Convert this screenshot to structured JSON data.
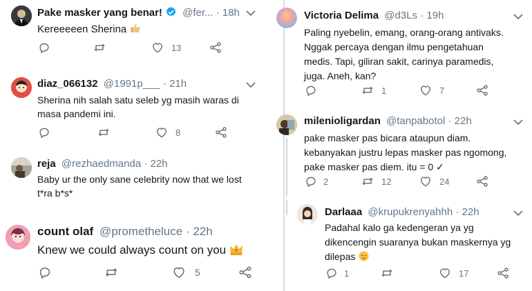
{
  "left_tweets": [
    {
      "name": "Pake masker yang benar!",
      "handle": "@fer...",
      "time": "18h",
      "text": "Kereeeeen Sherina",
      "reply": "",
      "retweet": "",
      "like": "13",
      "has_verified": true
    },
    {
      "name": "diaz_066132",
      "handle": "@1991p___",
      "time": "21h",
      "text": "Sherina nih salah satu seleb yg masih waras di\nmasa pandemi ini.",
      "reply": "",
      "retweet": "",
      "like": "8"
    },
    {
      "name": "reja",
      "handle": "@rezhaedmanda",
      "time": "22h",
      "text": "Baby ur the only sane celebrity now that we lost\nt*ra b*s*",
      "reply": "",
      "retweet": "",
      "like": ""
    },
    {
      "name": "count olaf",
      "handle": "@prometheluce",
      "time": "22h",
      "text": "Knew we could always count on you",
      "reply": "",
      "retweet": "",
      "like": "5"
    }
  ],
  "right_tweets": [
    {
      "name": "Victoria Delima",
      "handle": "@d3Ls",
      "time": "19h",
      "text": "Paling nyebelin, emang, orang-orang antivaks.\nNggak percaya dengan ilmu pengetahuan\nmedis. Tapi, giliran sakit, carinya paramedis,\njuga. Aneh, kan?",
      "reply": "",
      "retweet": "1",
      "like": "7"
    },
    {
      "name": "milenioligardan",
      "handle": "@tanpabotol",
      "time": "22h",
      "text": "pake masker pas bicara ataupun diam.\nkebanyakan justru lepas masker pas ngomong,\npake masker pas diem. itu = 0 ✓",
      "reply": "2",
      "retweet": "12",
      "like": "24"
    },
    {
      "name": "Darlaaa",
      "handle": "@krupukrenyahhh",
      "time": "22h",
      "text": "Padahal kalo ga kedengeran ya yg\ndikencengin suaranya bukan maskernya yg\ndilepas",
      "reply": "1",
      "retweet": "",
      "like": "17"
    }
  ],
  "colors": {
    "text": "#14171a",
    "muted": "#657786",
    "verified": "#1da1f2",
    "divider": "#d7dde2"
  },
  "icons": [
    "reply-icon",
    "retweet-icon",
    "like-icon",
    "share-icon",
    "chevron-down-icon",
    "verified-icon"
  ]
}
